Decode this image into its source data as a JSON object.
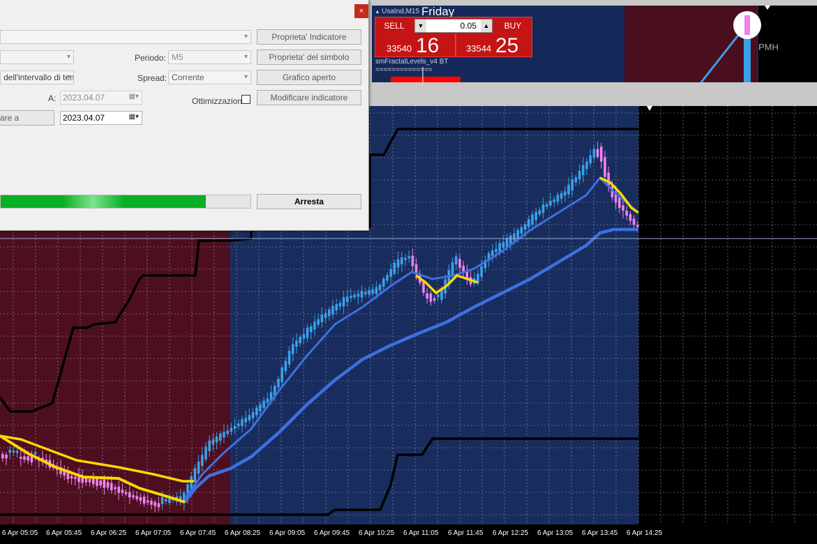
{
  "tester": {
    "periodo_label": "Periodo:",
    "periodo_value": "M5",
    "spread_label": "Spread:",
    "spread_value": "Corrente",
    "interval_value": "dell'intervallo di tem",
    "a_label": "A:",
    "a_date": "2023.04.07",
    "from_date": "2023.04.07",
    "use_date_btn": "are a",
    "ottimizzazione_label": "Ottimizzazione",
    "btn_indicator_props": "Proprieta' Indicatore",
    "btn_symbol_props": "Proprieta' del simbolo",
    "btn_open_chart": "Grafico aperto",
    "btn_modify_indicator": "Modificare indicatore",
    "btn_stop": "Arresta",
    "progress_fraction": 0.82,
    "close": "×"
  },
  "mini_chart": {
    "title": "UsaInd,M15",
    "overlay_text": "Friday",
    "indicator_name": "smFractalLevels_v4 BT",
    "indicator_line": "==============",
    "pmh_label": "PMH"
  },
  "one_click": {
    "sell_label": "SELL",
    "buy_label": "BUY",
    "lot": "0.05",
    "sell_small": "33540",
    "sell_big": "16",
    "buy_small": "33544",
    "buy_big": "25"
  },
  "chart_data": {
    "type": "candlestick",
    "x_ticks": [
      "6 Apr 05:05",
      "6 Apr 05:45",
      "6 Apr 06:25",
      "6 Apr 07:05",
      "6 Apr 07:45",
      "6 Apr 08:25",
      "6 Apr 09:05",
      "6 Apr 09:45",
      "6 Apr 10:25",
      "6 Apr 11:05",
      "6 Apr 11:45",
      "6 Apr 12:25",
      "6 Apr 13:05",
      "6 Apr 13:45",
      "6 Apr 14:25"
    ],
    "colors": {
      "bull": "#3ba0e8",
      "bear": "#ee82ee",
      "fast_ma": "#ffd700",
      "slow_ma": "#3f6fe0",
      "levels": "#000000",
      "session_bg": "#182d5e",
      "off_session_bg": "#4d0f20",
      "grid": "#9aa4b8"
    }
  }
}
